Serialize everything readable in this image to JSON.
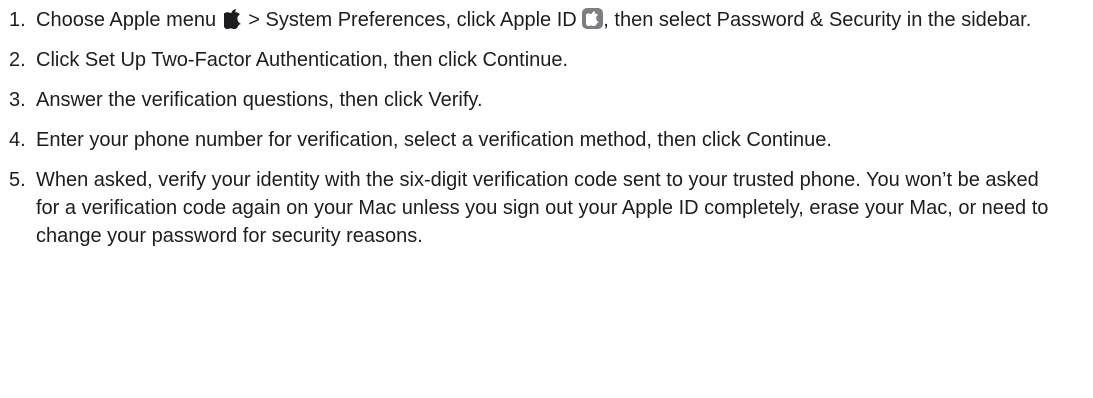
{
  "steps": [
    {
      "number": "1.",
      "before_apple_icon": "Choose Apple menu ",
      "after_apple_icon": " > System Preferences, click Apple ID ",
      "after_id_icon": ", then select Password & Security in the sidebar."
    },
    {
      "number": "2.",
      "text": "Click Set Up Two-Factor Authentication, then click Continue."
    },
    {
      "number": "3.",
      "text": "Answer the verification questions, then click Verify."
    },
    {
      "number": "4.",
      "text": "Enter your phone number for verification, select a verification method, then click Continue."
    },
    {
      "number": "5.",
      "text": " When asked, verify your identity with the six-digit verification code sent to your trusted phone. You won’t be asked for a verification code again on your Mac unless you sign out your Apple ID completely, erase your Mac, or need to change your password for security reasons."
    }
  ],
  "icons": {
    "apple_menu": "apple-logo-icon",
    "apple_id": "apple-id-icon"
  }
}
